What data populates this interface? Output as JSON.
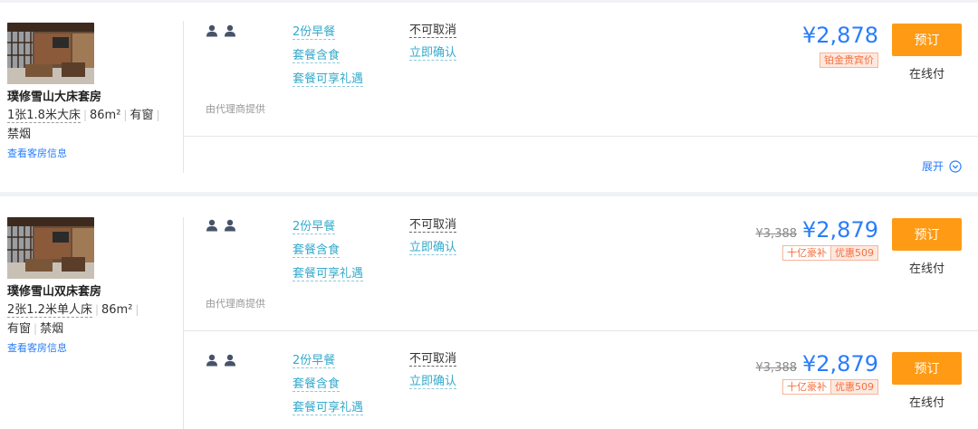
{
  "rooms": [
    {
      "name": "璞修雪山大床套房",
      "bed": "1张1.8米大床",
      "area": "86m²",
      "window": "有窗",
      "smoking": "禁烟",
      "link": "查看客房信息",
      "plans": [
        {
          "meals": [
            "2份早餐",
            "套餐含食",
            "套餐可享礼遇"
          ],
          "cancel": "不可取消",
          "confirm": "立即确认",
          "provider": "由代理商提供",
          "price": "¥2,878",
          "tag1": "铂金贵宾价",
          "book": "预订",
          "pay": "在线付"
        }
      ],
      "expand": "展开"
    },
    {
      "name": "璞修雪山双床套房",
      "bed": "2张1.2米单人床",
      "area": "86m²",
      "window": "有窗",
      "smoking": "禁烟",
      "link": "查看客房信息",
      "plans": [
        {
          "meals": [
            "2份早餐",
            "套餐含食",
            "套餐可享礼遇"
          ],
          "cancel": "不可取消",
          "confirm": "立即确认",
          "provider": "由代理商提供",
          "old_price": "¥3,388",
          "price": "¥2,879",
          "tag1": "十亿豪补",
          "tag2": "优惠509",
          "book": "预订",
          "pay": "在线付"
        },
        {
          "meals": [
            "2份早餐",
            "套餐含食",
            "套餐可享礼遇"
          ],
          "cancel": "不可取消",
          "confirm": "立即确认",
          "old_price": "¥3,388",
          "price": "¥2,879",
          "tag1": "十亿豪补",
          "tag2": "优惠509",
          "book": "预订",
          "pay": "在线付"
        }
      ]
    }
  ],
  "colors": {
    "accent": "#287dfa",
    "book": "#ff9a14",
    "meal": "#34aacc",
    "promo": "#f5703f"
  },
  "icons": {
    "guest": "person-icon",
    "expand": "chevron-down-circle-icon"
  }
}
